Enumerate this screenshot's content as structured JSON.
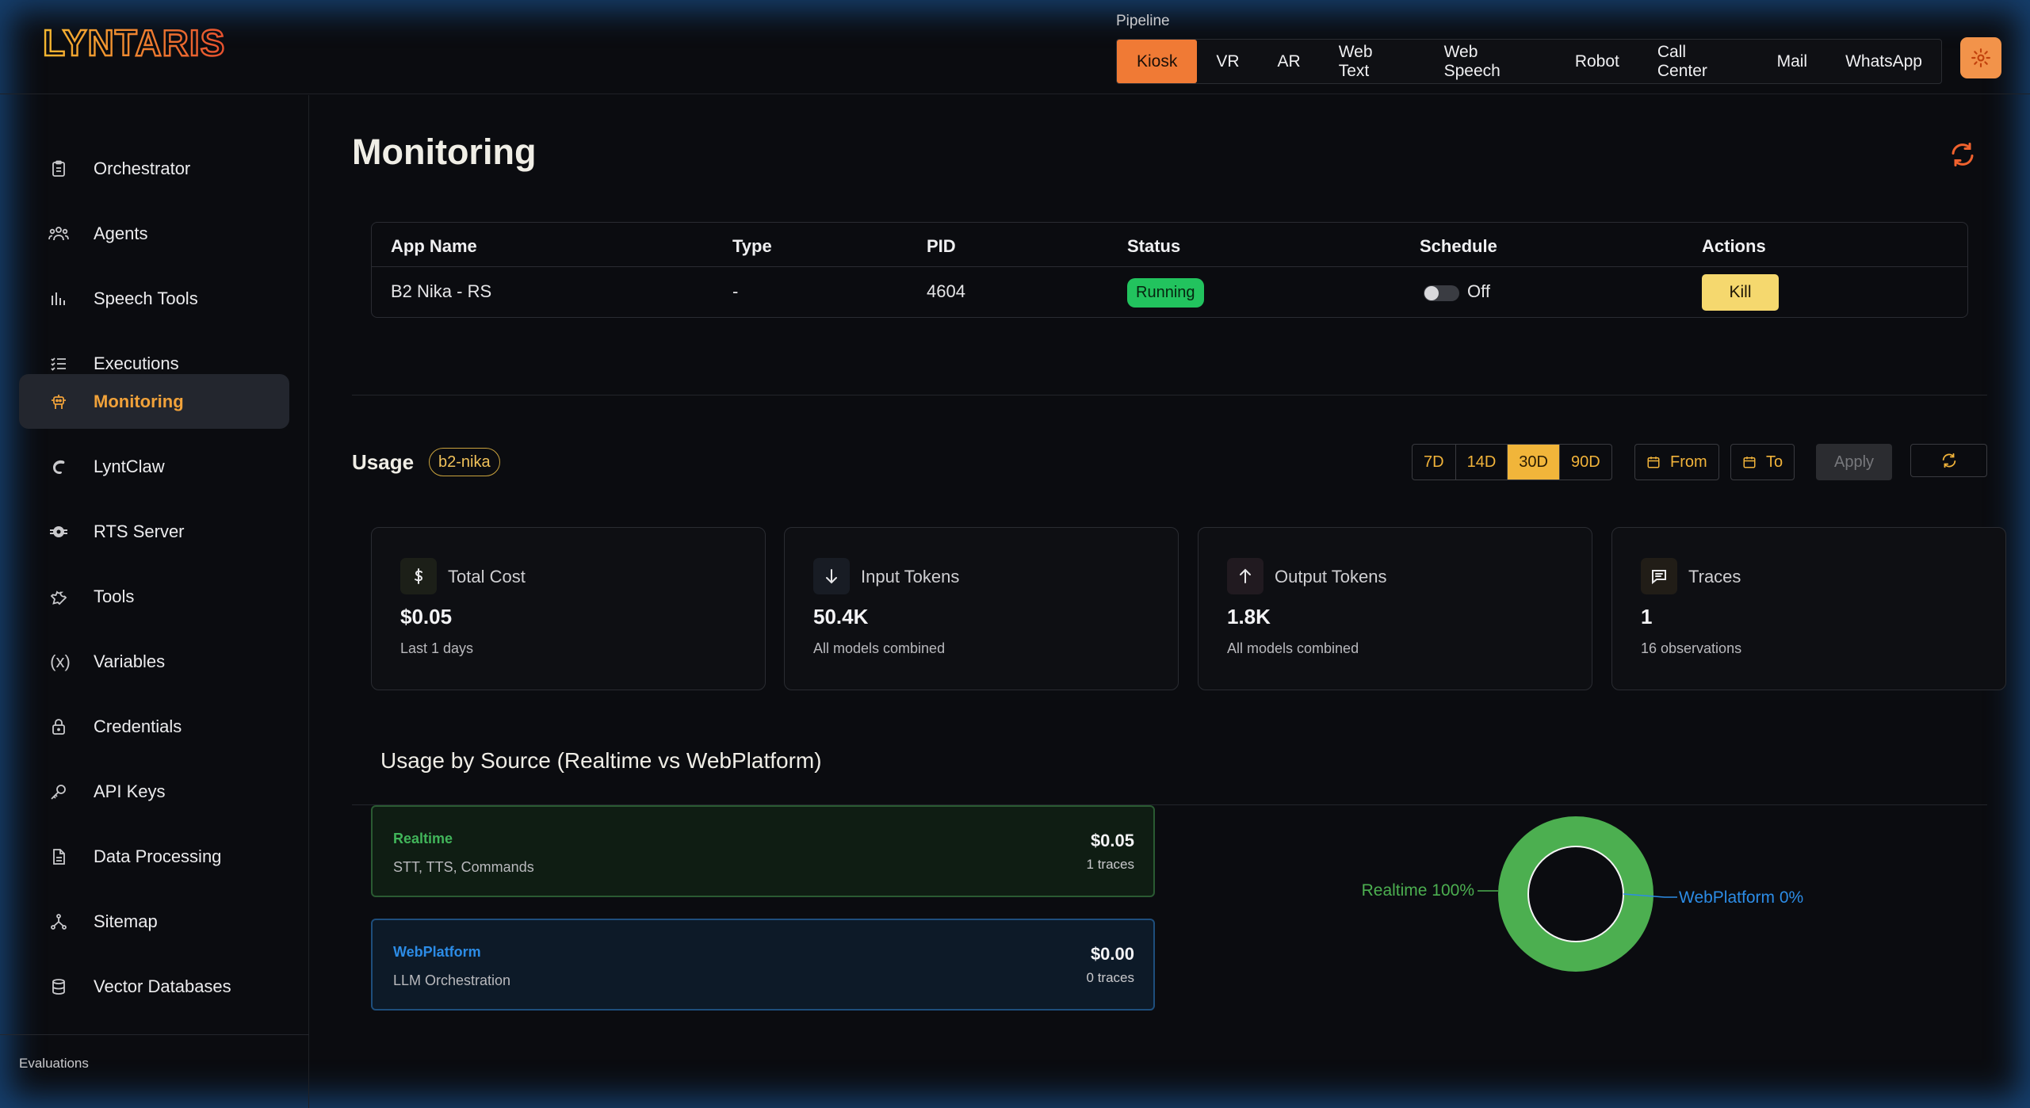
{
  "header": {
    "logo_text": "LYNTARIS",
    "pipeline_label": "Pipeline",
    "pipeline_tabs": [
      "Kiosk",
      "VR",
      "AR",
      "Web Text",
      "Web Speech",
      "Robot",
      "Call Center",
      "Mail",
      "WhatsApp"
    ],
    "active_pipeline": "Kiosk",
    "accent_color": "#f07a35"
  },
  "sidebar": {
    "items": [
      {
        "label": "Orchestrator",
        "icon": "clipboard-icon"
      },
      {
        "label": "Agents",
        "icon": "users-icon"
      },
      {
        "label": "Speech Tools",
        "icon": "bar-chart-icon"
      },
      {
        "label": "Executions",
        "icon": "checklist-icon"
      },
      {
        "label": "Monitoring",
        "icon": "robot-icon"
      },
      {
        "label": "LyntClaw",
        "icon": "claw-icon"
      },
      {
        "label": "RTS Server",
        "icon": "server-icon"
      },
      {
        "label": "Tools",
        "icon": "wrench-icon"
      },
      {
        "label": "Variables",
        "icon": "variable-icon"
      },
      {
        "label": "Credentials",
        "icon": "lock-icon"
      },
      {
        "label": "API Keys",
        "icon": "key-icon"
      },
      {
        "label": "Data Processing",
        "icon": "file-icon"
      },
      {
        "label": "Sitemap",
        "icon": "sitemap-icon"
      },
      {
        "label": "Vector Databases",
        "icon": "database-icon"
      }
    ],
    "active_item": "Monitoring",
    "section_label": "Evaluations"
  },
  "main": {
    "title": "Monitoring",
    "table": {
      "columns": [
        "App Name",
        "Type",
        "PID",
        "Status",
        "Schedule",
        "Actions"
      ],
      "rows": [
        {
          "app_name": "B2 Nika - RS",
          "type": "-",
          "pid": "4604",
          "status": "Running",
          "schedule": "Off",
          "action": "Kill"
        }
      ]
    },
    "usage": {
      "title": "Usage",
      "tag": "b2-nika",
      "ranges": [
        "7D",
        "14D",
        "30D",
        "90D"
      ],
      "active_range": "30D",
      "from_label": "From",
      "to_label": "To",
      "apply_label": "Apply"
    },
    "cards": [
      {
        "title": "Total Cost",
        "value": "$0.05",
        "sub": "Last 1 days",
        "icon": "dollar-icon"
      },
      {
        "title": "Input Tokens",
        "value": "50.4K",
        "sub": "All models combined",
        "icon": "arrow-down-icon"
      },
      {
        "title": "Output Tokens",
        "value": "1.8K",
        "sub": "All models combined",
        "icon": "arrow-up-icon"
      },
      {
        "title": "Traces",
        "value": "1",
        "sub": "16 observations",
        "icon": "message-icon"
      }
    ],
    "sources": {
      "title": "Usage by Source (Realtime vs WebPlatform)",
      "items": [
        {
          "name": "Realtime",
          "desc": "STT, TTS, Commands",
          "cost": "$0.05",
          "traces": "1 traces",
          "color": "#4caf50"
        },
        {
          "name": "WebPlatform",
          "desc": "LLM Orchestration",
          "cost": "$0.00",
          "traces": "0 traces",
          "color": "#2c8ce6"
        }
      ]
    }
  },
  "chart_data": {
    "type": "pie",
    "categories": [
      "Realtime",
      "WebPlatform"
    ],
    "values": [
      100,
      0
    ],
    "labels": [
      "Realtime 100%",
      "WebPlatform 0%"
    ],
    "colors": [
      "#4caf50",
      "#2c8ce6"
    ]
  }
}
